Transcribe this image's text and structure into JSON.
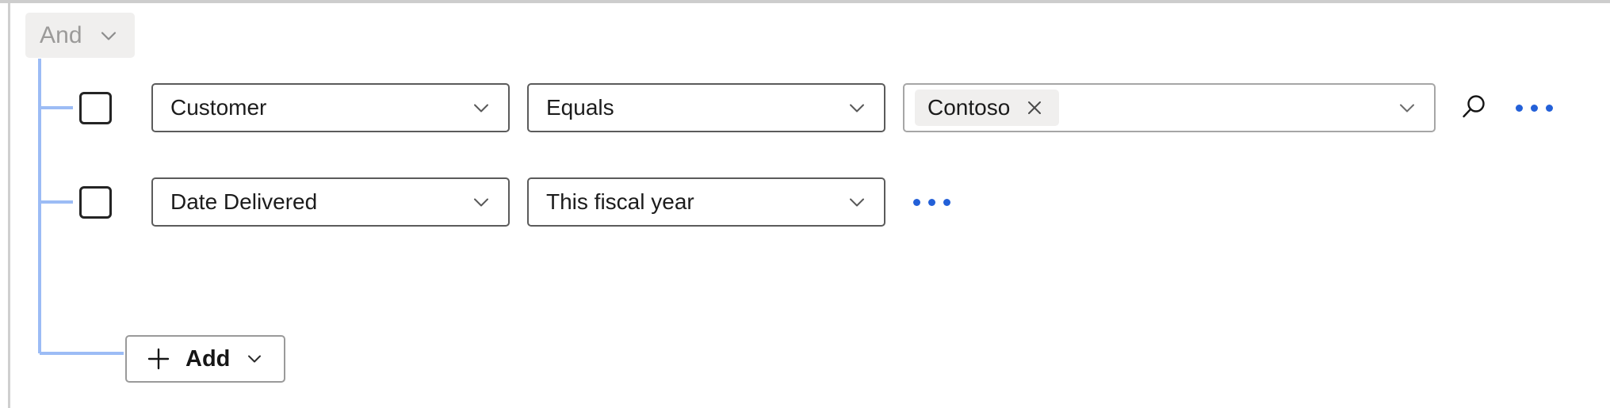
{
  "panel": {
    "name": "advanced-filter-builder"
  },
  "group": {
    "operator_label": "And",
    "chevron_icon": "chevron-down-icon"
  },
  "colors": {
    "connector_line": "#9cbcf5",
    "accent_blue": "#2360d8",
    "pill_background": "#f0efee",
    "field_border": "#5b5b5b",
    "value_field_border": "#a6a6a6",
    "disabled_text": "#9b9a99",
    "text": "#1c1c1c",
    "panel_rule": "#cdcdcd"
  },
  "conditions": [
    {
      "checkbox_checked": false,
      "property": "Customer",
      "operator": "Equals",
      "value_tags": [
        {
          "text": "Contoso",
          "remove_icon": "close-icon"
        }
      ],
      "has_search_button": true,
      "search_icon": "search-icon",
      "overflow_icon": "more-horizontal-icon"
    },
    {
      "checkbox_checked": false,
      "property": "Date Delivered",
      "operator": "This fiscal year",
      "value_tags": [],
      "has_search_button": false,
      "overflow_icon": "more-horizontal-icon"
    }
  ],
  "add": {
    "label": "Add",
    "plus_icon": "plus-icon",
    "chevron_icon": "chevron-down-icon"
  }
}
